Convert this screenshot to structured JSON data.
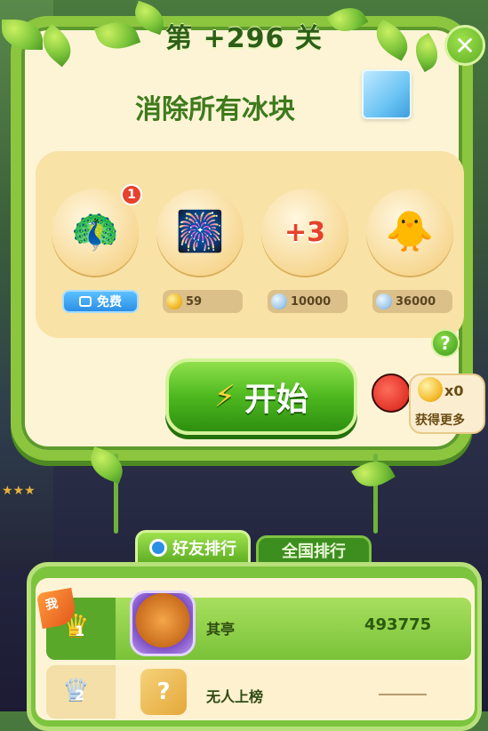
{
  "header": {
    "level_title": "第 +296 关",
    "close_icon": "close-icon"
  },
  "goal": {
    "text": "消除所有冰块",
    "icon": "ice-block-icon"
  },
  "boosters": [
    {
      "name": "rainbow-bird",
      "icon": "rainbow-bird-icon",
      "badge": "1",
      "price_label": "免费",
      "currency": "video"
    },
    {
      "name": "rocket-pack",
      "icon": "rocket-icon",
      "price": "59",
      "currency": "gold-coin"
    },
    {
      "name": "plus-three-moves",
      "icon": "plus-three-icon",
      "price": "10000",
      "currency": "silver-coin"
    },
    {
      "name": "animal-pair",
      "icon": "animal-pair-icon",
      "price": "36000",
      "currency": "silver-coin"
    }
  ],
  "start_button": {
    "label": "开始",
    "icon": "lightning-icon"
  },
  "help_icon": "question-icon",
  "get_more": {
    "count": "x0",
    "label": "获得更多"
  },
  "tabs": [
    {
      "label": "好友排行",
      "active": true
    },
    {
      "label": "全国排行",
      "active": false
    }
  ],
  "ranking": [
    {
      "rank": "1",
      "me_tag": "我",
      "name": "其亭",
      "score": "493775"
    },
    {
      "rank": "2",
      "name": "无人上榜",
      "score": ""
    }
  ],
  "colors": {
    "accent_green": "#4db81f",
    "panel_cream": "#fdf4d6",
    "badge_red": "#e8412c",
    "free_blue": "#2b8fe6"
  }
}
